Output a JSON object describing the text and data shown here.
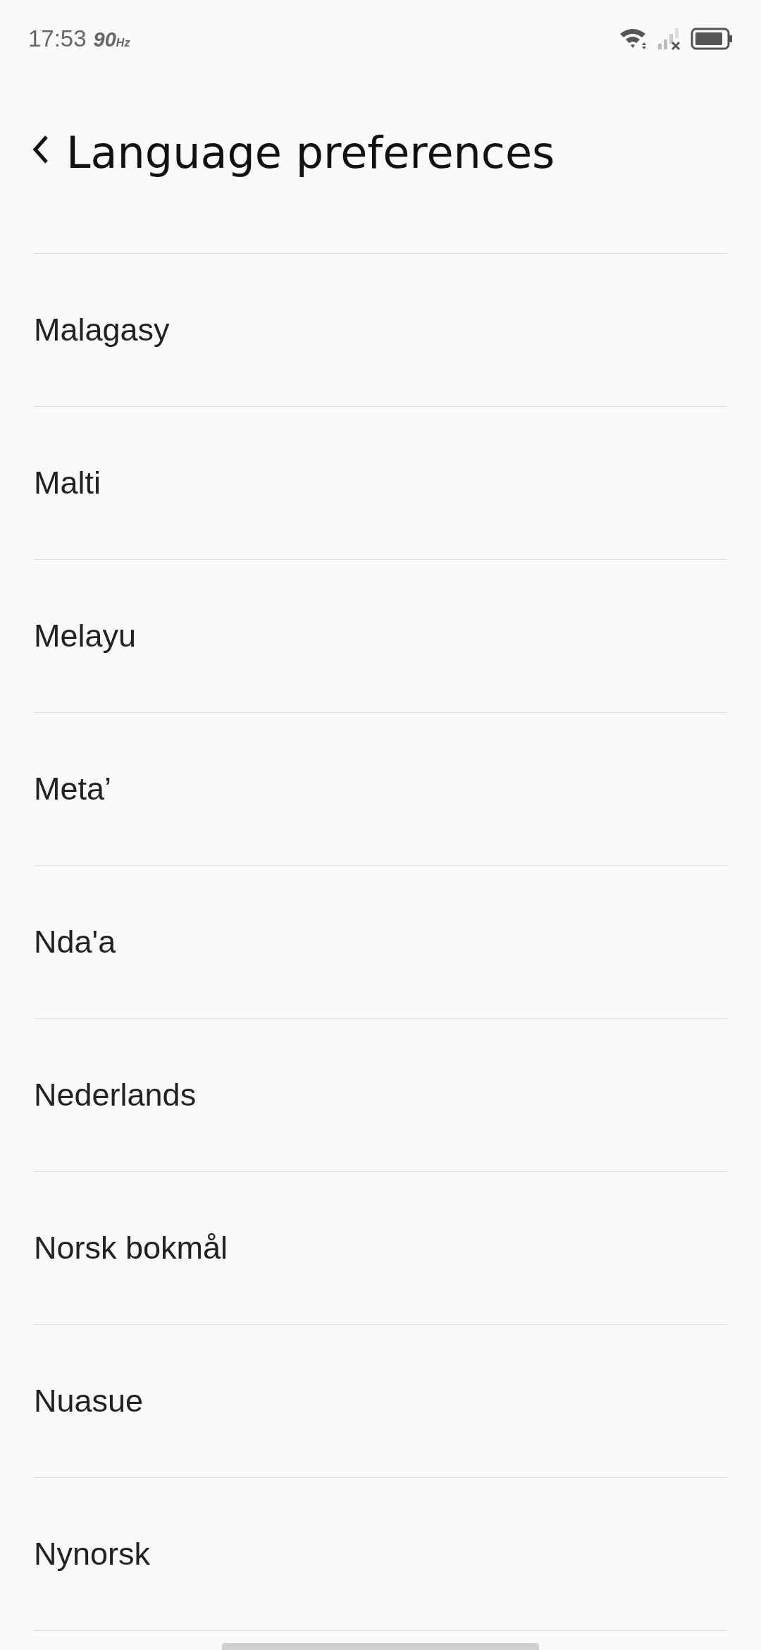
{
  "status_bar": {
    "time": "17:53",
    "refresh_rate": "90",
    "refresh_unit": "Hz"
  },
  "header": {
    "title": "Language preferences"
  },
  "languages": [
    "Malagasy",
    "Malti",
    "Melayu",
    "Meta’",
    "Nda'a",
    "Nederlands",
    "Norsk bokmål",
    "Nuasue",
    "Nynorsk"
  ]
}
